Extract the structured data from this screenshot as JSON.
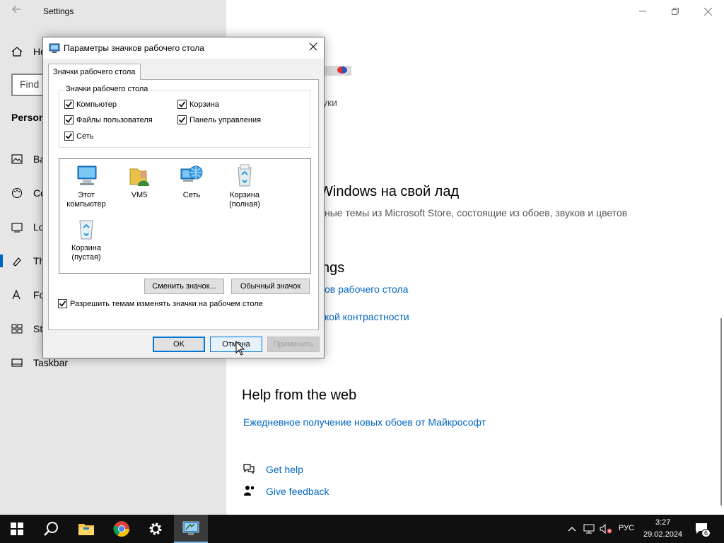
{
  "settings": {
    "title": "Settings",
    "search_placeholder": "Find",
    "section_heading": "Person",
    "nav": [
      {
        "label": "Ho",
        "icon": "home-icon"
      },
      {
        "label": "Ba",
        "icon": "picture-icon"
      },
      {
        "label": "Co",
        "icon": "palette-icon"
      },
      {
        "label": "Lo",
        "icon": "lockscreen-icon"
      },
      {
        "label": "Th",
        "icon": "brush-icon"
      },
      {
        "label": "Fo",
        "icon": "font-icon"
      },
      {
        "label": "St",
        "icon": "start-icon"
      },
      {
        "label": "Taskbar",
        "icon": "taskbar-icon"
      }
    ],
    "main": {
      "partial_sounds": "уки",
      "personalize_heading": "Windows на свой лад",
      "personalize_desc": "ные темы из Microsoft Store, состоящие из обоев, звуков и цветов",
      "related_heading": "ngs",
      "link_desktop_icons": "ов рабочего стола",
      "link_high_contrast": "кой контрастности",
      "help_heading": "Help from the web",
      "help_link": "Ежедневное получение новых обоев от Майкрософт",
      "get_help": "Get help",
      "give_feedback": "Give feedback"
    }
  },
  "dialog": {
    "title": "Параметры значков рабочего стола",
    "tab_label": "Значки рабочего стола",
    "group_label": "Значки рабочего стола",
    "checkboxes": [
      {
        "label": "Компьютер",
        "checked": true
      },
      {
        "label": "Корзина",
        "checked": true
      },
      {
        "label": "Файлы пользователя",
        "checked": true
      },
      {
        "label": "Панель управления",
        "checked": true
      },
      {
        "label": "Сеть",
        "checked": true
      }
    ],
    "icons": [
      {
        "label": "Этот компьютер",
        "icon": "computer-icon"
      },
      {
        "label": "VM5",
        "icon": "user-folder-icon"
      },
      {
        "label": "Сеть",
        "icon": "network-icon"
      },
      {
        "label": "Корзина (полная)",
        "icon": "recycle-bin-full-icon"
      },
      {
        "label": "Корзина (пустая)",
        "icon": "recycle-bin-empty-icon"
      }
    ],
    "change_icon_button": "Сменить значок...",
    "default_icon_button": "Обычный значок",
    "allow_themes_label": "Разрешить темам изменять значки на рабочем столе",
    "allow_themes_checked": true,
    "ok_button": "OK",
    "cancel_button": "Отмена",
    "apply_button": "Применить"
  },
  "taskbar": {
    "language": "РУС",
    "time": "3:27",
    "date": "29.02.2024",
    "notification_count": "6"
  },
  "colors": {
    "accent": "#0067c0",
    "sidebar_bg": "#e6e6e6",
    "taskbar_bg": "#101010"
  }
}
